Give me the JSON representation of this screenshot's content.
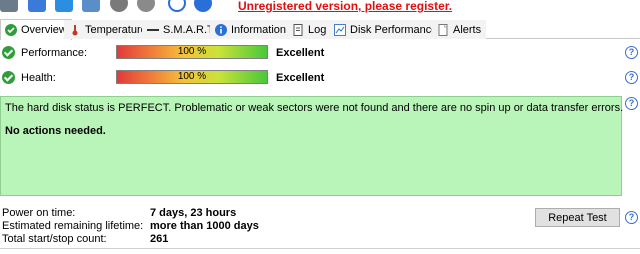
{
  "toolbar": {
    "unregistered_text": "Unregistered version, please register."
  },
  "tabs": [
    {
      "label": "Overview",
      "icon": "overview-icon"
    },
    {
      "label": "Temperature",
      "icon": "thermometer-icon"
    },
    {
      "label": "S.M.A.R.T.",
      "icon": "smart-dash-icon"
    },
    {
      "label": "Information",
      "icon": "info-icon"
    },
    {
      "label": "Log",
      "icon": "document-icon"
    },
    {
      "label": "Disk Performance",
      "icon": "chart-icon"
    },
    {
      "label": "Alerts",
      "icon": "alerts-icon"
    }
  ],
  "overview": {
    "performance_label": "Performance:",
    "performance_value": "100 %",
    "performance_level": 1.0,
    "performance_rating": "Excellent",
    "health_label": "Health:",
    "health_value": "100 %",
    "health_level": 1.0,
    "health_rating": "Excellent",
    "status_text": "The hard disk status is PERFECT. Problematic or weak sectors were not found and there are no spin up or data transfer errors.",
    "status_action": "No actions needed.",
    "power_on_label": "Power on time:",
    "power_on_value": "7 days, 23 hours",
    "remaining_label": "Estimated remaining lifetime:",
    "remaining_value": "more than 1000 days",
    "startstop_label": "Total start/stop count:",
    "startstop_value": "261",
    "repeat_button": "Repeat Test",
    "help_glyph": "?"
  },
  "colors": {
    "status_bg": "#b9f5b9",
    "ok_green": "#2f9e3a",
    "unregistered_red": "#e01010",
    "help_blue": "#3a6fd0"
  }
}
